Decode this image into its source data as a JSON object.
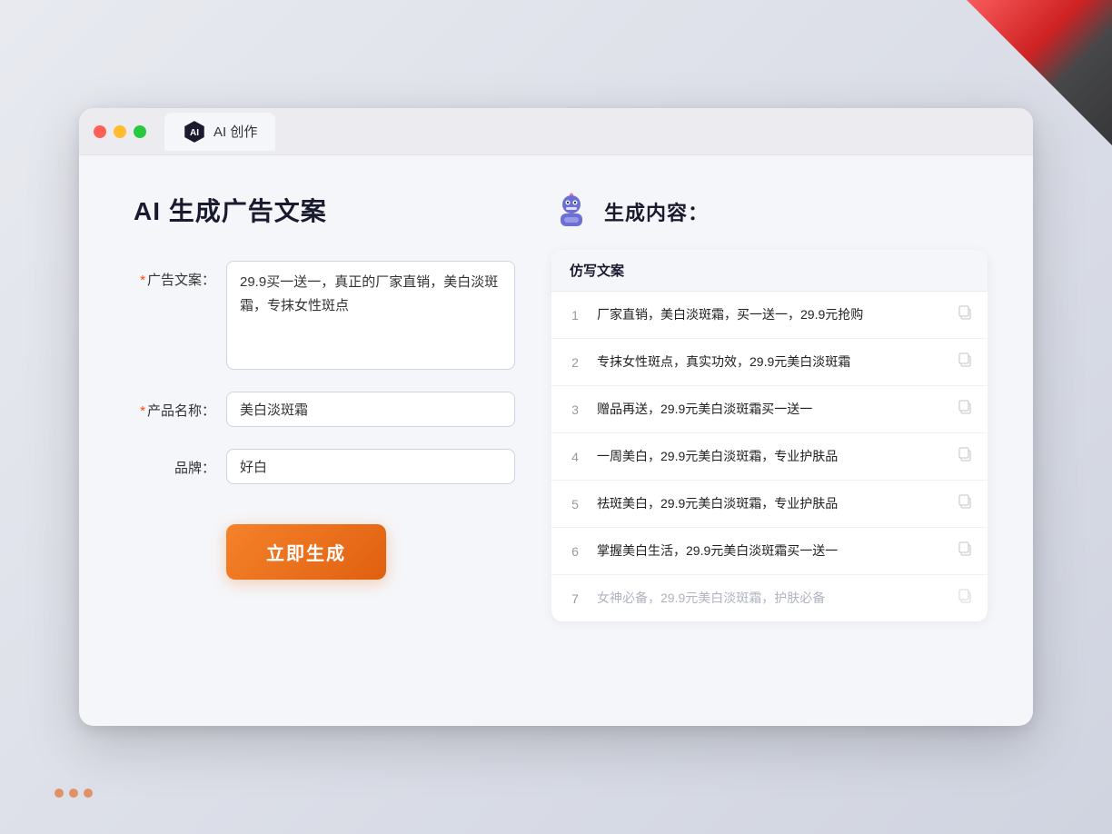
{
  "window": {
    "tab_label": "AI 创作"
  },
  "page": {
    "title": "AI 生成广告文案"
  },
  "form": {
    "ad_copy_label": "广告文案：",
    "ad_copy_required": "*",
    "ad_copy_value": "29.9买一送一，真正的厂家直销，美白淡斑霜，专抹女性斑点",
    "product_name_label": "产品名称：",
    "product_name_required": "*",
    "product_name_value": "美白淡斑霜",
    "brand_label": "品牌：",
    "brand_value": "好白",
    "generate_btn": "立即生成"
  },
  "result": {
    "header_title": "生成内容：",
    "table_header": "仿写文案",
    "items": [
      {
        "num": "1",
        "text": "厂家直销，美白淡斑霜，买一送一，29.9元抢购",
        "muted": false
      },
      {
        "num": "2",
        "text": "专抹女性斑点，真实功效，29.9元美白淡斑霜",
        "muted": false
      },
      {
        "num": "3",
        "text": "赠品再送，29.9元美白淡斑霜买一送一",
        "muted": false
      },
      {
        "num": "4",
        "text": "一周美白，29.9元美白淡斑霜，专业护肤品",
        "muted": false
      },
      {
        "num": "5",
        "text": "祛斑美白，29.9元美白淡斑霜，专业护肤品",
        "muted": false
      },
      {
        "num": "6",
        "text": "掌握美白生活，29.9元美白淡斑霜买一送一",
        "muted": false
      },
      {
        "num": "7",
        "text": "女神必备，29.9元美白淡斑霜，护肤必备",
        "muted": true
      }
    ]
  }
}
